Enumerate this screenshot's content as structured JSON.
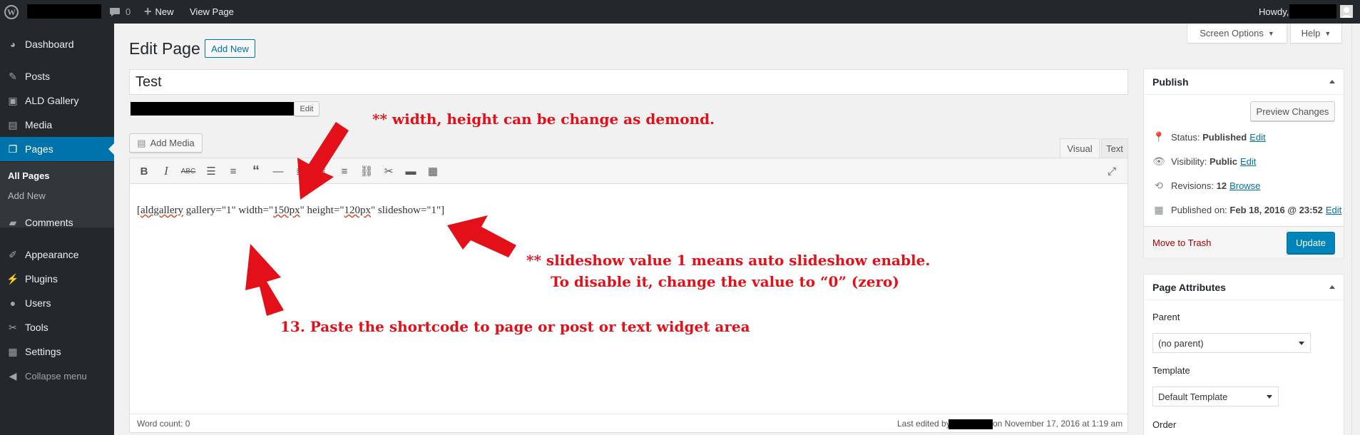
{
  "admin_bar": {
    "comments_count": "0",
    "new_label": "New",
    "view_page_label": "View Page",
    "howdy_label": "Howdy,"
  },
  "sidebar": {
    "items": [
      {
        "label": "Dashboard",
        "icon": "dashboard-icon"
      },
      {
        "label": "Posts",
        "icon": "pin-icon"
      },
      {
        "label": "ALD Gallery",
        "icon": "gallery-icon"
      },
      {
        "label": "Media",
        "icon": "media-icon"
      },
      {
        "label": "Pages",
        "icon": "page-icon"
      },
      {
        "label": "Comments",
        "icon": "comment-icon"
      },
      {
        "label": "Appearance",
        "icon": "brush-icon"
      },
      {
        "label": "Plugins",
        "icon": "plug-icon"
      },
      {
        "label": "Users",
        "icon": "user-icon"
      },
      {
        "label": "Tools",
        "icon": "wrench-icon"
      },
      {
        "label": "Settings",
        "icon": "settings-icon"
      }
    ],
    "submenu": [
      "All Pages",
      "Add New"
    ],
    "collapse_label": "Collapse menu"
  },
  "header": {
    "screen_options": "Screen Options",
    "help": "Help",
    "title": "Edit Page",
    "add_new": "Add New"
  },
  "post": {
    "title_value": "Test",
    "permalink_edit": "Edit",
    "add_media": "Add Media",
    "tab_visual": "Visual",
    "tab_text": "Text",
    "content_parts": [
      "[",
      "aldgallery",
      " gallery=\"1\" width=\"",
      "150px",
      "\" height=\"",
      "120px",
      "\" slideshow=\"1\"]"
    ],
    "word_count": "Word count: 0",
    "last_edited_prefix": "Last edited by",
    "last_edited_suffix": "on November 17, 2016 at 1:19 am"
  },
  "publish": {
    "title": "Publish",
    "preview": "Preview Changes",
    "status_label": "Status: ",
    "status_value": "Published",
    "visibility_label": "Visibility: ",
    "visibility_value": "Public",
    "revisions_label": "Revisions: ",
    "revisions_value": "12",
    "browse": "Browse",
    "published_on_label": "Published on: ",
    "published_on_value": "Feb 18, 2016 @ 23:52",
    "edit": "Edit",
    "trash": "Move to Trash",
    "update": "Update"
  },
  "page_attributes": {
    "title": "Page Attributes",
    "parent_label": "Parent",
    "parent_value": "(no parent)",
    "template_label": "Template",
    "template_value": "Default Template",
    "order_label": "Order"
  },
  "annotations": {
    "width_note": "** width, height can be change as demond.",
    "slideshow_note_1": "** slideshow value 1 means auto slideshow enable.",
    "slideshow_note_2": "To disable it, change the value to “0” (zero)",
    "paste_note": "13. Paste the shortcode to page or post or text widget area"
  },
  "colors": {
    "admin_dark": "#23282d",
    "accent_blue": "#0073aa",
    "annotation_red": "#e3101a"
  }
}
